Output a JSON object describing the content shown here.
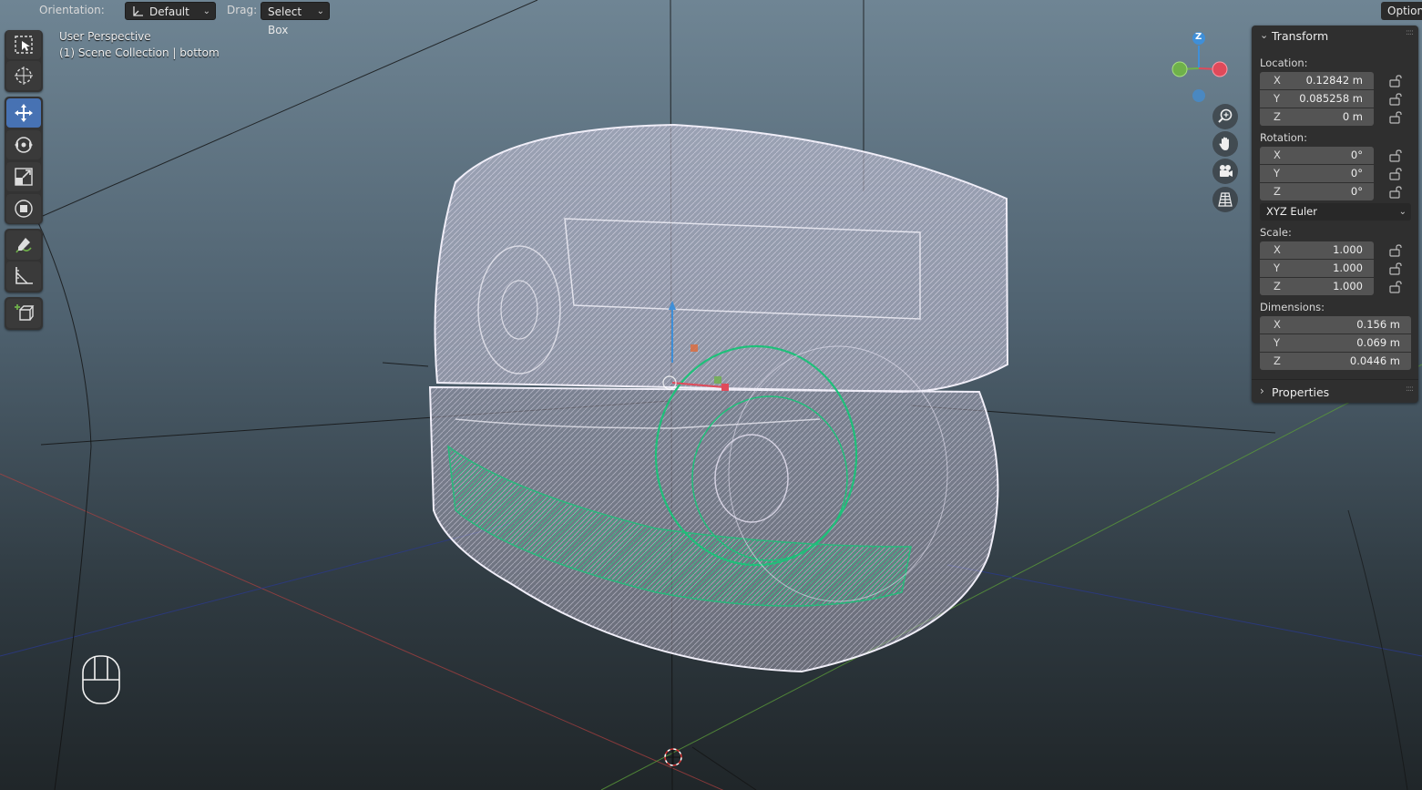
{
  "header": {
    "orientation_label": "Orientation:",
    "orientation_value": "Default",
    "drag_label": "Drag:",
    "drag_value": "Select Box",
    "options_label": "Options"
  },
  "viewport": {
    "perspective_label": "User Perspective",
    "collection_label": "(1) Scene Collection | bottom"
  },
  "gizmo": {
    "z_axis": "Z"
  },
  "toolbar": {
    "tools": [
      {
        "name": "select-box",
        "icon": "select-box-icon",
        "active": false
      },
      {
        "name": "cursor",
        "icon": "cursor-icon",
        "active": false
      },
      {
        "name": "move",
        "icon": "move-icon",
        "active": true
      },
      {
        "name": "rotate",
        "icon": "rotate-icon",
        "active": false
      },
      {
        "name": "scale",
        "icon": "scale-icon",
        "active": false
      },
      {
        "name": "transform",
        "icon": "transform-icon",
        "active": false
      },
      {
        "name": "annotate",
        "icon": "annotate-icon",
        "active": false
      },
      {
        "name": "measure",
        "icon": "measure-icon",
        "active": false
      },
      {
        "name": "add-cube",
        "icon": "add-cube-icon",
        "active": false
      }
    ]
  },
  "panel": {
    "transform_title": "Transform",
    "location_label": "Location:",
    "location": [
      {
        "axis": "X",
        "value": "0.12842 m"
      },
      {
        "axis": "Y",
        "value": "0.085258 m"
      },
      {
        "axis": "Z",
        "value": "0 m"
      }
    ],
    "rotation_label": "Rotation:",
    "rotation": [
      {
        "axis": "X",
        "value": "0°"
      },
      {
        "axis": "Y",
        "value": "0°"
      },
      {
        "axis": "Z",
        "value": "0°"
      }
    ],
    "rotation_mode": "XYZ Euler",
    "scale_label": "Scale:",
    "scale": [
      {
        "axis": "X",
        "value": "1.000"
      },
      {
        "axis": "Y",
        "value": "1.000"
      },
      {
        "axis": "Z",
        "value": "1.000"
      }
    ],
    "dimensions_label": "Dimensions:",
    "dimensions": [
      {
        "axis": "X",
        "value": "0.156 m"
      },
      {
        "axis": "Y",
        "value": "0.069 m"
      },
      {
        "axis": "Z",
        "value": "0.0446 m"
      }
    ],
    "properties_title": "Properties"
  },
  "colors": {
    "accent": "#4772b3",
    "axis_x": "#e04a5a",
    "axis_y": "#6fb14a",
    "axis_z": "#3f8fd8",
    "wire": "#d8d4e8",
    "selected_wire": "#22c07a"
  }
}
